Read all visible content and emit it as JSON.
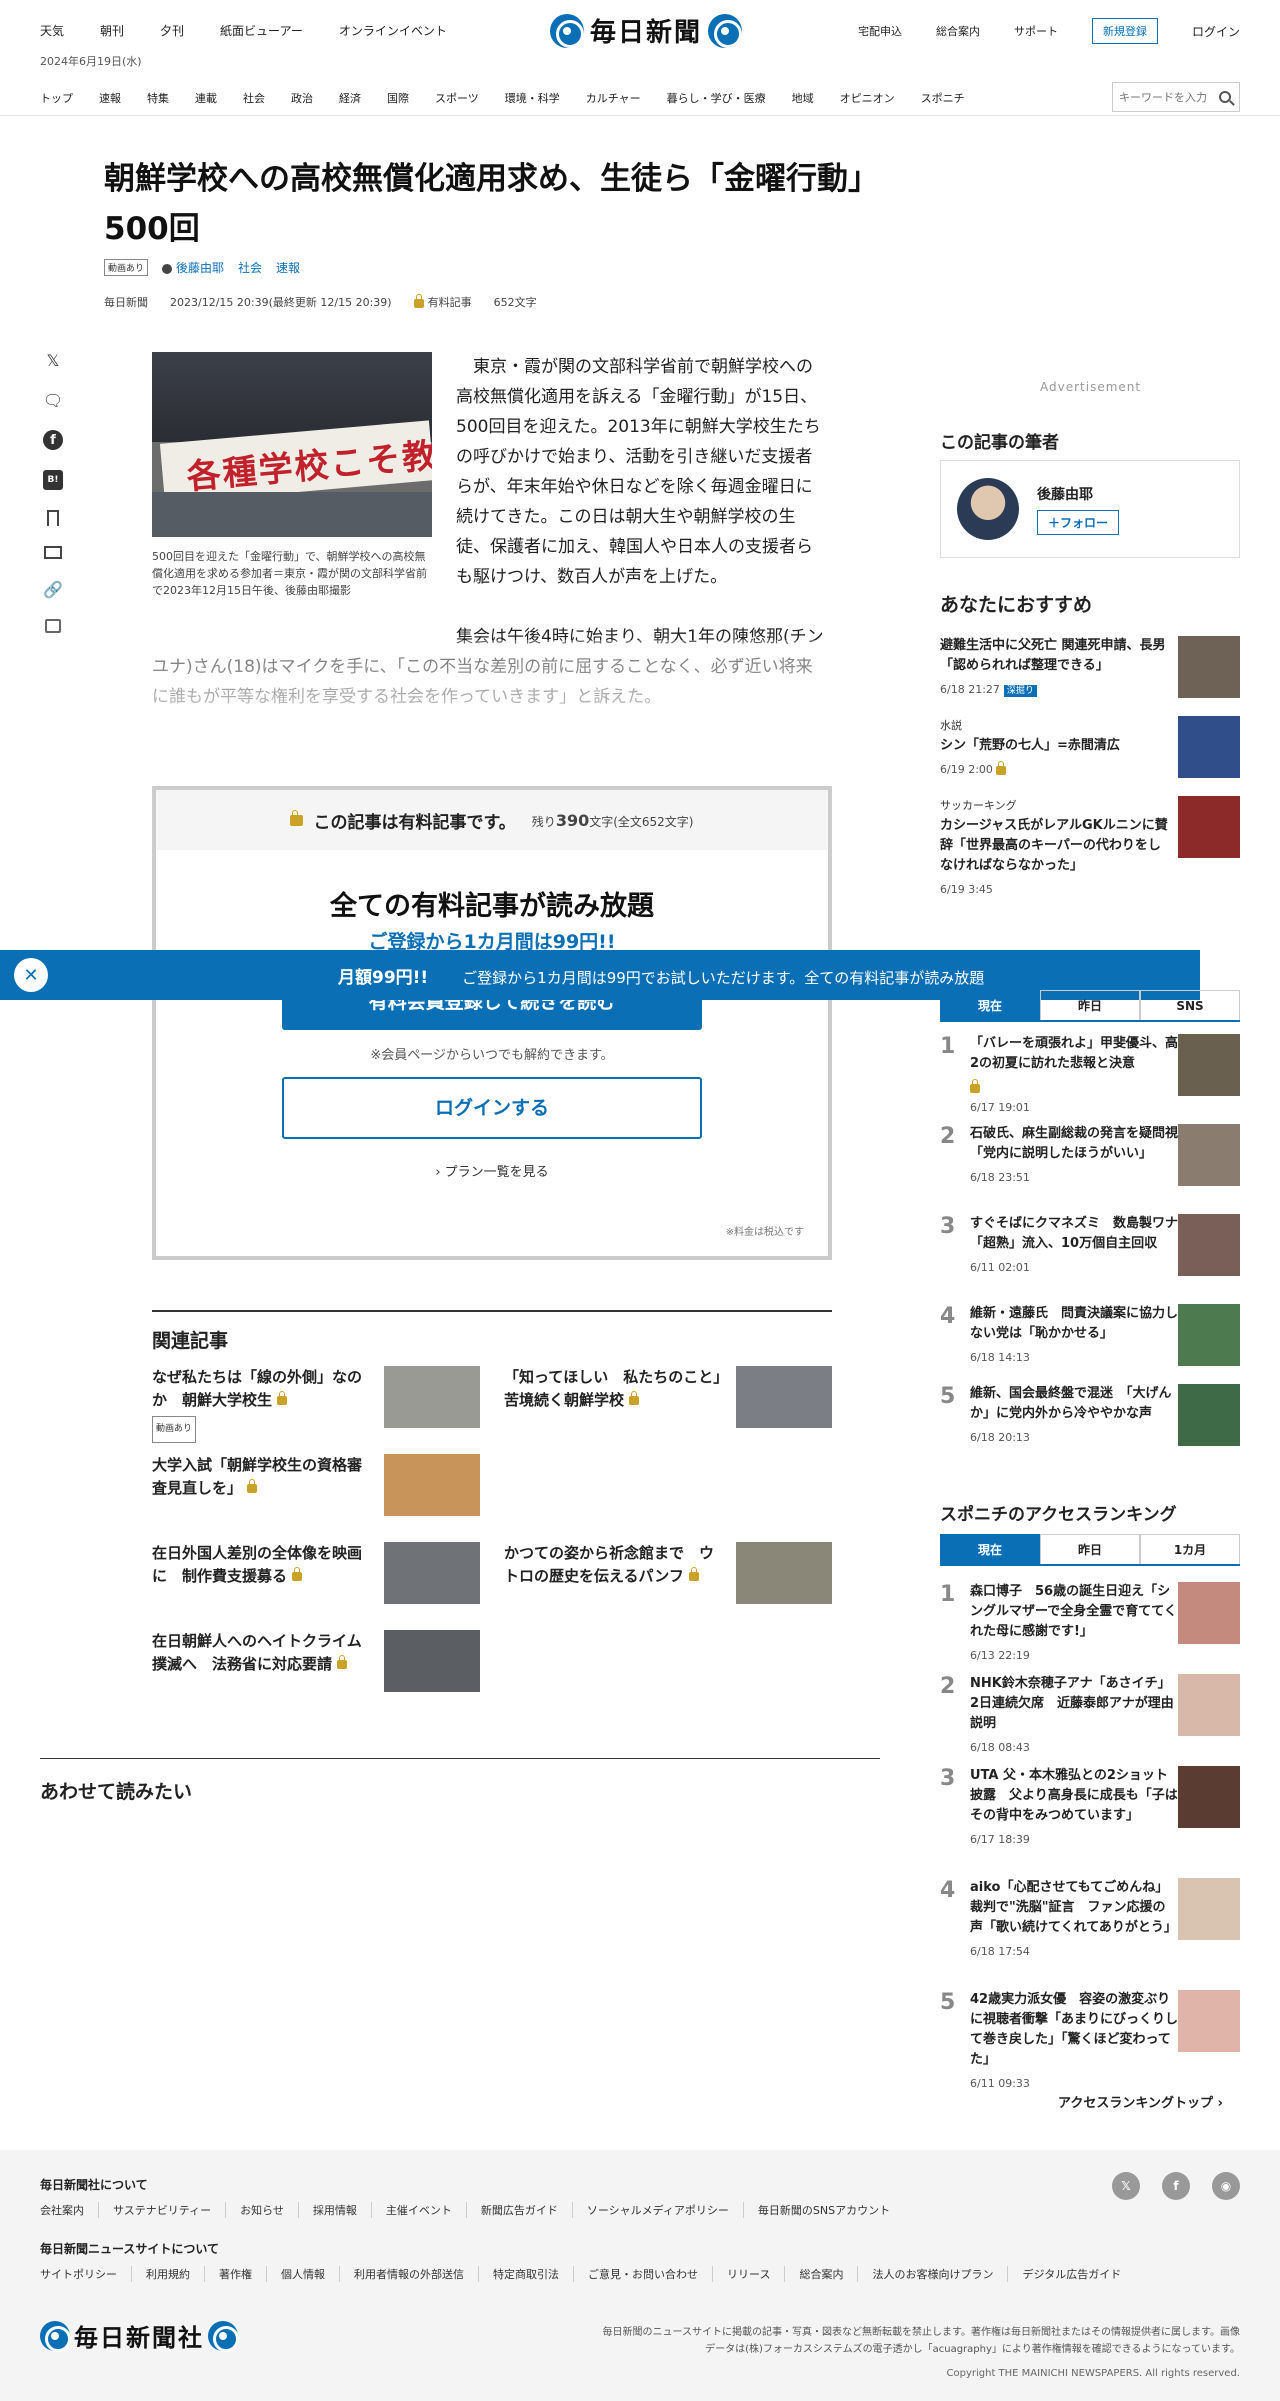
{
  "header": {
    "top_links": [
      "天気",
      "朝刊",
      "夕刊",
      "紙面ビューアー",
      "オンラインイベント"
    ],
    "date": "2024年6月19日(水)",
    "logo": "毎日新聞",
    "right_links": [
      "宅配申込",
      "総合案内",
      "サポート"
    ],
    "register": "新規登録",
    "login": "ログイン",
    "nav": [
      "トップ",
      "速報",
      "特集",
      "連載",
      "社会",
      "政治",
      "経済",
      "国際",
      "スポーツ",
      "環境・科学",
      "カルチャー",
      "暮らし・学び・医療",
      "地域",
      "オピニオン",
      "スポニチ"
    ],
    "search_placeholder": "キーワードを入力"
  },
  "article": {
    "title": "朝鮮学校への高校無償化適用求め、生徒ら「金曜行動」500回",
    "badge": "動画あり",
    "author": "後藤由耶",
    "category": "社会",
    "tag": "速報",
    "source": "毎日新聞",
    "datetime": "2023/12/15 20:39(最終更新 12/15 20:39)",
    "paid_label": "有料記事",
    "char_count": "652文字",
    "photo_banner": "各種学校こそ教育保障の権利を",
    "caption": "500回目を迎えた「金曜行動」で、朝鮮学校への高校無償化適用を求める参加者＝東京・霞が関の文部科学省前で2023年12月15日午後、後藤由耶撮影",
    "paragraph1": "東京・霞が関の文部科学省前で朝鮮学校への高校無償化適用を訴える「金曜行動」が15日、500回目を迎えた。2013年に朝鮮大学校生たちの呼びかけで始まり、活動を引き継いだ支援者らが、年末年始や休日などを除く毎週金曜日に続けてきた。この日は朝大生や朝鮮学校の生徒、保護者に加え、韓国人や日本人の支援者らも駆けつけ、数百人が声を上げた。",
    "paragraph2": "集会は午後4時に始まり、朝大1年の陳悠那(チンユナ)さん(18)はマイクを手に、「この不当な差別の前に屈することなく、必ず近い将来に誰もが平等な権利を享受する社会を作っていきます」と訴えた。"
  },
  "share": {
    "x": "𝕏",
    "fb": "f",
    "hatena": "B!"
  },
  "paywall": {
    "header": "この記事は有料記事です。",
    "remaining_prefix": "残り",
    "remaining": "390",
    "remaining_suffix": "文字(全文652文字)",
    "title": "全ての有料記事が読み放題",
    "subtitle": "ご登録から1カ月間は99円!!",
    "cta": "有料会員登録して続きを読む",
    "note": "※会員ページからいつでも解約できます。",
    "login": "ログインする",
    "plans": "プラン一覧を見る",
    "tax": "※料金は税込です"
  },
  "promo": {
    "text": "月額99円!!",
    "sub": "ご登録から1カ月間は99円でお試しいただけます。全ての有料記事が読み放題"
  },
  "related": {
    "heading": "関連記事",
    "items": [
      {
        "title": "なぜ私たちは「線の外側」なのか　朝鮮大学校生",
        "badge": "動画あり"
      },
      {
        "title": "「知ってほしい　私たちのこと」　苦境続く朝鮮学校",
        "badge": ""
      },
      {
        "title": "大学入試「朝鮮学校生の資格審査見直しを」",
        "badge": ""
      },
      {
        "title": "在日外国人差別の全体像を映画に　制作費支援募る",
        "badge": ""
      },
      {
        "title": "かつての姿から祈念館まで　ウトロの歴史を伝えるパンフ",
        "badge": ""
      },
      {
        "title": "在日朝鮮人へのヘイトクライム撲滅へ　法務省に対応要請",
        "badge": ""
      }
    ]
  },
  "also_read": "あわせて読みたい",
  "sidebar": {
    "ad": "Advertisement",
    "author_heading": "この記事の筆者",
    "author_name": "後藤由耶",
    "follow": "＋フォロー",
    "rec_heading": "あなたにおすすめ",
    "recs": [
      {
        "category": "",
        "title": "避難生活中に父死亡 関連死申請、長男「認められれば整理できる」",
        "time": "6/18 21:27",
        "deep": "深掘り"
      },
      {
        "category": "水説",
        "title": "シン「荒野の七人」=赤間清広",
        "time": "6/19 2:00",
        "deep": ""
      },
      {
        "category": "サッカーキング",
        "title": "カシージャス氏がレアルGKルニンに賛辞「世界最高のキーパーの代わりをしなければならなかった」",
        "time": "6/19 3:45",
        "deep": ""
      }
    ],
    "tabs": [
      "現在",
      "昨日",
      "SNS"
    ],
    "ranking": [
      {
        "title": "「バレーを頑張れよ」甲斐優斗、高2の初夏に訪れた悲報と決意",
        "time": "6/17 19:01"
      },
      {
        "title": "石破氏、麻生副総裁の発言を疑問視　「党内に説明したほうがいい」",
        "time": "6/18 23:51"
      },
      {
        "title": "すぐそばにクマネズミ　数島製ワナ「超熟」流入、10万個自主回収",
        "time": "6/11 02:01"
      },
      {
        "title": "維新・遠藤氏　問責決議案に協力しない党は「恥かかせる」",
        "time": "6/18 14:13"
      },
      {
        "title": "維新、国会最終盤で混迷　「大げんか」に党内外から冷ややかな声",
        "time": "6/18 20:13"
      }
    ],
    "suponichi_heading": "スポニチのアクセスランキング",
    "tabs2": [
      "現在",
      "昨日",
      "1カ月"
    ],
    "ranking2": [
      {
        "title": "森口博子　56歳の誕生日迎え「シングルマザーで全身全霊で育ててくれた母に感謝です!」",
        "time": "6/13 22:19"
      },
      {
        "title": "NHK鈴木奈穂子アナ「あさイチ」2日連続欠席　近藤泰郎アナが理由説明",
        "time": "6/18 08:43"
      },
      {
        "title": "UTA 父・本木雅弘との2ショット披露　父より高身長に成長も「子はその背中をみつめています」",
        "time": "6/17 18:39"
      },
      {
        "title": "aiko「心配させてもてごめんね」裁判で\"洗脳\"証言　ファン応援の声「歌い続けてくれてありがとう」",
        "time": "6/18 17:54"
      },
      {
        "title": "42歳実力派女優　容姿の激変ぶりに視聴者衝撃「あまりにびっくりして巻き戻した」「驚くほど変わってた」",
        "time": "6/11 09:33"
      }
    ],
    "ranking_link": "アクセスランキングトップ ›"
  },
  "footer": {
    "about_heading": "毎日新聞社について",
    "about_links": [
      "会社案内",
      "サステナビリティー",
      "お知らせ",
      "採用情報",
      "主催イベント",
      "新聞広告ガイド",
      "ソーシャルメディアポリシー",
      "毎日新聞のSNSアカウント"
    ],
    "site_heading": "毎日新聞ニュースサイトについて",
    "site_links": [
      "サイトポリシー",
      "利用規約",
      "著作権",
      "個人情報",
      "利用者情報の外部送信",
      "特定商取引法",
      "ご意見・お問い合わせ",
      "リリース",
      "総合案内",
      "法人のお客様向けプラン",
      "デジタル広告ガイド"
    ],
    "logo": "毎日新聞社",
    "note": "毎日新聞のニュースサイトに掲載の記事・写真・図表など無断転載を禁止します。著作権は毎日新聞社またはその情報提供者に属します。画像データは(株)フォーカスシステムズの電子透かし「acuagraphy」により著作権情報を確認できるようになっています。",
    "copyright": "Copyright THE MAINICHI NEWSPAPERS. All rights reserved."
  }
}
